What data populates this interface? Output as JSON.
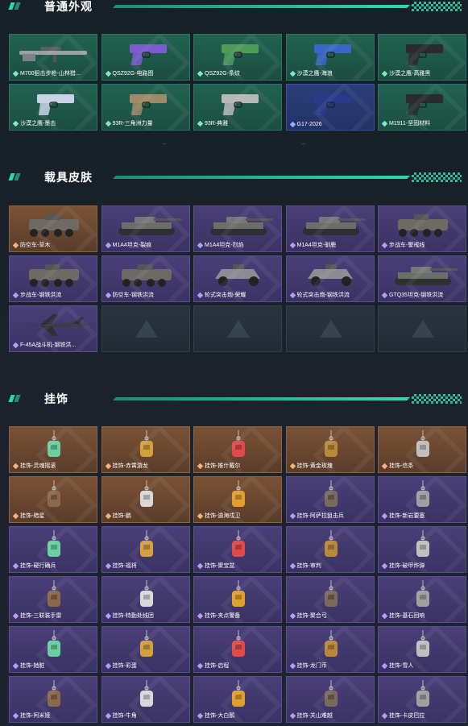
{
  "sections": [
    {
      "title": "普通外观",
      "items": [
        {
          "label": "M700狙击步枪-山林猎...",
          "rarity": "green",
          "icon": "sniper-rifle-icon"
        },
        {
          "label": "QSZ92G-电路图",
          "rarity": "green",
          "icon": "pistol-icon"
        },
        {
          "label": "QSZ92G-条纹",
          "rarity": "green",
          "icon": "pistol-icon"
        },
        {
          "label": "沙漠之鹰-海浪",
          "rarity": "green",
          "icon": "pistol-icon"
        },
        {
          "label": "沙漠之鹰-高雅黑",
          "rarity": "green",
          "icon": "pistol-icon"
        },
        {
          "label": "沙漠之鹰-墨击",
          "rarity": "green",
          "icon": "pistol-icon"
        },
        {
          "label": "93R-三角洲力量",
          "rarity": "green",
          "icon": "pistol-icon"
        },
        {
          "label": "93R-典雅",
          "rarity": "green",
          "icon": "pistol-icon"
        },
        {
          "label": "G17-2026",
          "rarity": "blue",
          "icon": "pistol-icon"
        },
        {
          "label": "M1911-坚固材料",
          "rarity": "green",
          "icon": "pistol-icon"
        }
      ]
    },
    {
      "title": "载具皮肤",
      "items": [
        {
          "label": "防空车-草木",
          "rarity": "orange",
          "icon": "apc-icon"
        },
        {
          "label": "M1A4坦克-裂痕",
          "rarity": "purple",
          "icon": "tank-icon"
        },
        {
          "label": "M1A4坦克-烈焰",
          "rarity": "purple",
          "icon": "tank-icon"
        },
        {
          "label": "M1A4坦克-驯鹿",
          "rarity": "purple",
          "icon": "tank-icon"
        },
        {
          "label": "步战车-警戒线",
          "rarity": "purple",
          "icon": "apc-icon"
        },
        {
          "label": "步战车-钢铁洪流",
          "rarity": "purple",
          "icon": "apc-icon"
        },
        {
          "label": "防空车-钢铁洪流",
          "rarity": "purple",
          "icon": "apc-icon"
        },
        {
          "label": "轮式突击炮-荣耀",
          "rarity": "purple",
          "icon": "buggy-icon"
        },
        {
          "label": "轮式突击炮-钢铁洪流",
          "rarity": "purple",
          "icon": "buggy-icon"
        },
        {
          "label": "GTQ35坦克-钢铁洪流",
          "rarity": "purple",
          "icon": "tank-icon"
        },
        {
          "label": "F-45A战斗机-钢铁洪...",
          "rarity": "purple",
          "icon": "jet-icon"
        },
        {
          "label": "",
          "rarity": "empty",
          "icon": "empty-slot-icon"
        },
        {
          "label": "",
          "rarity": "empty",
          "icon": "empty-slot-icon"
        },
        {
          "label": "",
          "rarity": "empty",
          "icon": "empty-slot-icon"
        },
        {
          "label": "",
          "rarity": "empty",
          "icon": "empty-slot-icon"
        }
      ]
    },
    {
      "title": "挂饰",
      "items": [
        {
          "label": "挂饰-灵魂摇滚",
          "rarity": "orange",
          "icon": "charm-icon"
        },
        {
          "label": "挂饰-赤霄游龙",
          "rarity": "orange",
          "icon": "charm-icon"
        },
        {
          "label": "挂饰-推什戴尔",
          "rarity": "orange",
          "icon": "charm-icon"
        },
        {
          "label": "挂饰-黄金玫瑰",
          "rarity": "orange",
          "icon": "charm-icon"
        },
        {
          "label": "挂饰-信条",
          "rarity": "orange",
          "icon": "charm-icon"
        },
        {
          "label": "挂饰-暗星",
          "rarity": "orange",
          "icon": "charm-icon"
        },
        {
          "label": "挂饰-鹏",
          "rarity": "orange",
          "icon": "charm-icon"
        },
        {
          "label": "挂饰-逾海戍卫",
          "rarity": "orange",
          "icon": "charm-icon"
        },
        {
          "label": "挂饰-阿萨拉狙击兵",
          "rarity": "purple",
          "icon": "charm-icon"
        },
        {
          "label": "挂饰-新岩要塞",
          "rarity": "purple",
          "icon": "charm-icon"
        },
        {
          "label": "挂饰-硬行确兵",
          "rarity": "purple",
          "icon": "charm-icon"
        },
        {
          "label": "挂饰-福将",
          "rarity": "purple",
          "icon": "charm-icon"
        },
        {
          "label": "挂饰-聚宝盆",
          "rarity": "purple",
          "icon": "charm-icon"
        },
        {
          "label": "挂饰-审判",
          "rarity": "purple",
          "icon": "charm-icon"
        },
        {
          "label": "挂饰-破甲炸弹",
          "rarity": "purple",
          "icon": "charm-icon"
        },
        {
          "label": "挂饰-三联装手雷",
          "rarity": "purple",
          "icon": "charm-icon"
        },
        {
          "label": "挂饰-特勤处线团",
          "rarity": "purple",
          "icon": "charm-icon"
        },
        {
          "label": "挂饰-夹点警备",
          "rarity": "purple",
          "icon": "charm-icon"
        },
        {
          "label": "挂饰-聚合弓",
          "rarity": "purple",
          "icon": "charm-icon"
        },
        {
          "label": "挂饰-基石回响",
          "rarity": "purple",
          "icon": "charm-icon"
        },
        {
          "label": "挂饰-她脏",
          "rarity": "purple",
          "icon": "charm-icon"
        },
        {
          "label": "挂饰-彩蛋",
          "rarity": "purple",
          "icon": "charm-icon"
        },
        {
          "label": "挂饰-启程",
          "rarity": "purple",
          "icon": "charm-icon"
        },
        {
          "label": "挂饰-龙门币",
          "rarity": "purple",
          "icon": "charm-icon"
        },
        {
          "label": "挂饰-雪人",
          "rarity": "purple",
          "icon": "charm-icon"
        },
        {
          "label": "挂饰-阿米娅",
          "rarity": "purple",
          "icon": "charm-icon"
        },
        {
          "label": "挂饰-牛角",
          "rarity": "purple",
          "icon": "charm-icon"
        },
        {
          "label": "挂饰-大白鹅",
          "rarity": "purple",
          "icon": "charm-icon"
        },
        {
          "label": "挂饰-关山难越",
          "rarity": "purple",
          "icon": "charm-icon"
        },
        {
          "label": "挂饰-卡皮巴拉",
          "rarity": "purple",
          "icon": "charm-icon"
        }
      ]
    }
  ],
  "colors": {
    "accent": "#2fd9ab",
    "green_tile": "#21634f",
    "orange_tile": "#7a5235",
    "purple_tile": "#4a3f78",
    "blue_tile": "#2b3e7a"
  }
}
